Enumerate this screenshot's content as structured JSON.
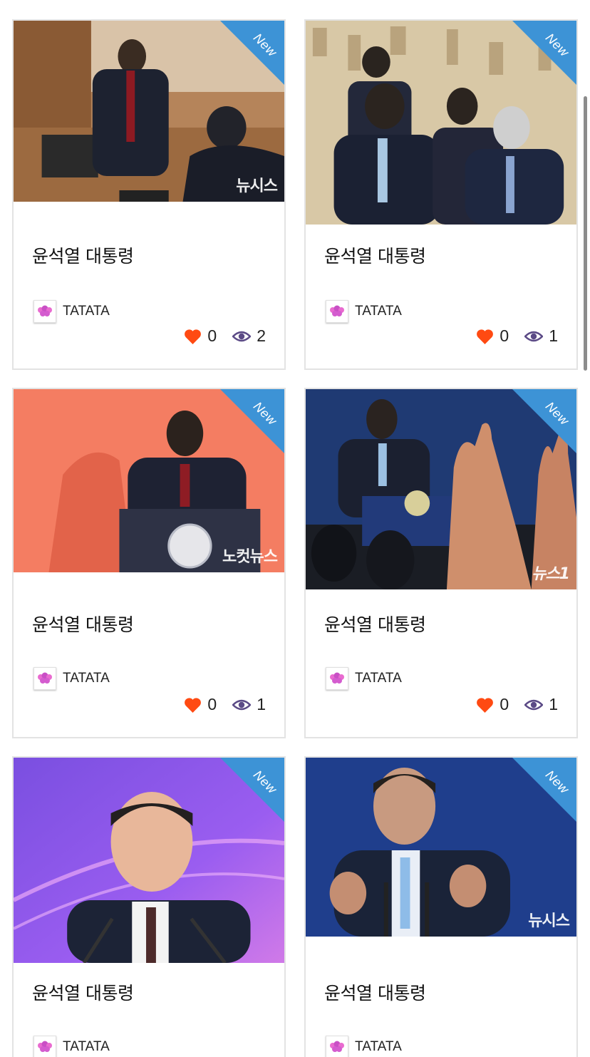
{
  "accent": {
    "ribbon": "#3d93d6",
    "heart": "#ff4a12",
    "eye": "#5b4a86"
  },
  "ribbon_label": "New",
  "cards": [
    {
      "title": "윤석열 대통령",
      "author": "TATATA",
      "likes": "0",
      "views": "2",
      "watermark": "뉴시스"
    },
    {
      "title": "윤석열 대통령",
      "author": "TATATA",
      "likes": "0",
      "views": "1",
      "watermark": ""
    },
    {
      "title": "윤석열 대통령",
      "author": "TATATA",
      "likes": "0",
      "views": "1",
      "watermark": "노컷뉴스"
    },
    {
      "title": "윤석열 대통령",
      "author": "TATATA",
      "likes": "0",
      "views": "1",
      "watermark": "뉴스1"
    },
    {
      "title": "윤석열 대통령",
      "author": "TATATA",
      "likes": "",
      "views": "",
      "watermark": ""
    },
    {
      "title": "윤석열 대통령",
      "author": "TATATA",
      "likes": "",
      "views": "",
      "watermark": "뉴시스"
    }
  ]
}
